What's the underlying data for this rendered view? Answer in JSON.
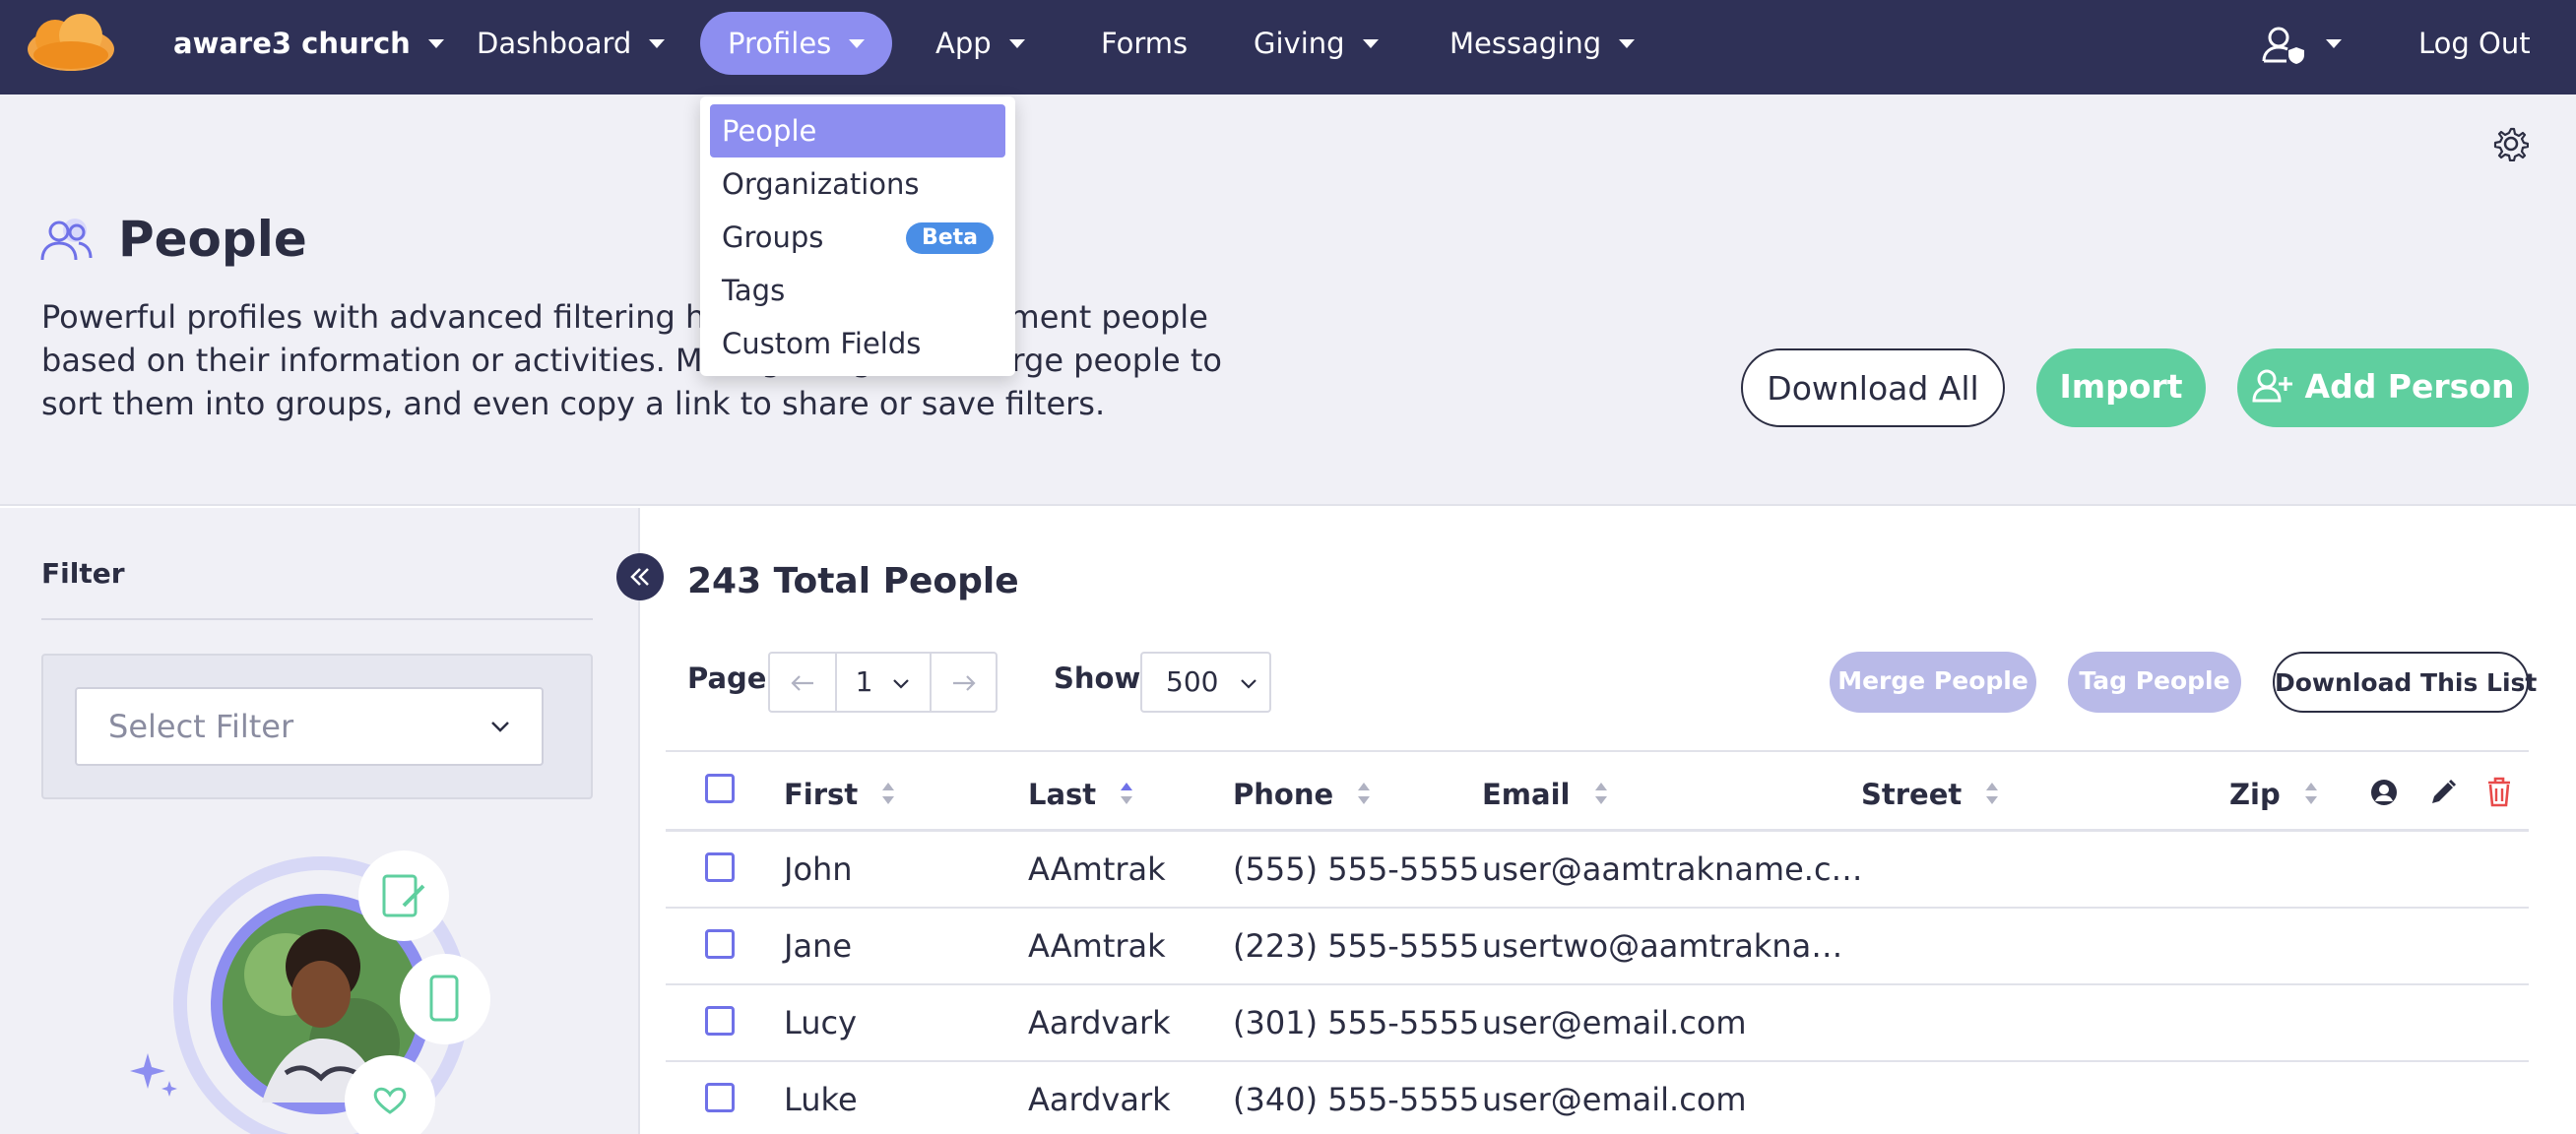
{
  "nav": {
    "brand": "aware3 church",
    "items": [
      {
        "label": "Dashboard"
      },
      {
        "label": "Profiles"
      },
      {
        "label": "App"
      },
      {
        "label": "Forms"
      },
      {
        "label": "Giving"
      },
      {
        "label": "Messaging"
      }
    ],
    "logout": "Log Out"
  },
  "dropdown": {
    "items": [
      {
        "label": "People"
      },
      {
        "label": "Organizations"
      },
      {
        "label": "Groups",
        "badge": "Beta"
      },
      {
        "label": "Tags"
      },
      {
        "label": "Custom Fields"
      }
    ]
  },
  "header": {
    "title": "People",
    "description": "Powerful profiles with advanced filtering help you quickly segment people based on their information or activities. Manage, tag, and merge people to sort them into groups, and even copy a link to share or save filters.",
    "download_all": "Download All",
    "import": "Import",
    "add_person": "Add Person"
  },
  "sidebar": {
    "filter_label": "Filter",
    "select_placeholder": "Select Filter"
  },
  "main": {
    "total": "243 Total People",
    "page_label": "Page",
    "page_value": "1",
    "show_label": "Show",
    "show_value": "500",
    "merge": "Merge People",
    "tag": "Tag People",
    "download_list": "Download This List"
  },
  "table": {
    "columns": [
      "First",
      "Last",
      "Phone",
      "Email",
      "Street",
      "Zip"
    ],
    "rows": [
      {
        "first": "John",
        "last": "AAmtrak",
        "phone": "(555) 555-5555",
        "email": "user@aamtrakname.c…",
        "street": "",
        "zip": ""
      },
      {
        "first": "Jane",
        "last": "AAmtrak",
        "phone": "(223) 555-5555",
        "email": "usertwo@aamtrakna…",
        "street": "",
        "zip": ""
      },
      {
        "first": "Lucy",
        "last": "Aardvark",
        "phone": "(301) 555-5555",
        "email": "user@email.com",
        "street": "",
        "zip": ""
      },
      {
        "first": "Luke",
        "last": "Aardvark",
        "phone": "(340) 555-5555",
        "email": "user@email.com",
        "street": "",
        "zip": ""
      }
    ]
  },
  "colors": {
    "nav_bg": "#2f3157",
    "accent": "#8d8ef0",
    "green": "#5fcf9f",
    "beta": "#4a8ee6",
    "danger": "#e84a4a"
  },
  "icons": [
    "logo",
    "chevron-down-icon",
    "user-shield-icon",
    "gear-icon",
    "people-icon",
    "add-user-icon",
    "collapse-left-icon",
    "arrow-left-icon",
    "arrow-right-icon",
    "sort-icon",
    "user-circle-icon",
    "pencil-icon",
    "trash-icon"
  ]
}
